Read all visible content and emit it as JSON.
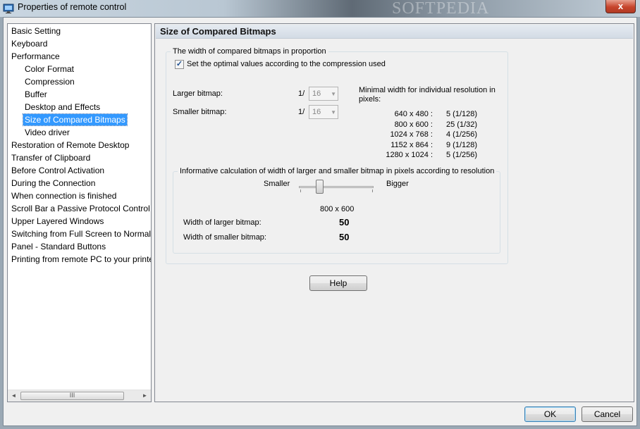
{
  "window": {
    "title": "Properties of remote control",
    "close_glyph": "x",
    "watermark": "SOFTPEDIA"
  },
  "tree": {
    "items": [
      {
        "label": "Basic Setting",
        "level": 0
      },
      {
        "label": "Keyboard",
        "level": 0
      },
      {
        "label": "Performance",
        "level": 0
      },
      {
        "label": "Color Format",
        "level": 1
      },
      {
        "label": "Compression",
        "level": 1
      },
      {
        "label": "Buffer",
        "level": 1
      },
      {
        "label": "Desktop and Effects",
        "level": 1
      },
      {
        "label": "Size of Compared Bitmaps",
        "level": 1,
        "selected": true
      },
      {
        "label": "Video driver",
        "level": 1
      },
      {
        "label": "Restoration of Remote Desktop",
        "level": 0
      },
      {
        "label": "Transfer of Clipboard",
        "level": 0
      },
      {
        "label": "Before Control Activation",
        "level": 0
      },
      {
        "label": "During the Connection",
        "level": 0
      },
      {
        "label": "When connection is finished",
        "level": 0
      },
      {
        "label": "Scroll Bar a Passive Protocol Control",
        "level": 0
      },
      {
        "label": "Upper Layered Windows",
        "level": 0
      },
      {
        "label": "Switching from Full Screen to Normal",
        "level": 0
      },
      {
        "label": "Panel - Standard Buttons",
        "level": 0
      },
      {
        "label": "Printing from remote PC to your printer",
        "level": 0
      }
    ],
    "scroll_left": "◄",
    "scroll_right": "►",
    "scroll_grip": "III"
  },
  "panel": {
    "title": "Size of Compared Bitmaps",
    "proportion_group": {
      "title": "The width of compared bitmaps in proportion",
      "optimal_checkbox_label": "Set the optimal values according to the compression used",
      "optimal_checked": true,
      "larger_label": "Larger bitmap:",
      "smaller_label": "Smaller bitmap:",
      "ratio_prefix": "1/",
      "larger_value": "16",
      "smaller_value": "16",
      "minimal_width_label": "Minimal width for individual resolution in pixels:",
      "resolutions": [
        "640 x 480 :",
        "800 x 600 :",
        "1024 x 768 :",
        "1152 x 864 :",
        "1280 x 1024 :"
      ],
      "resolution_values": [
        "5 (1/128)",
        "25 (1/32)",
        "4 (1/256)",
        "9 (1/128)",
        "5 (1/256)"
      ]
    },
    "informative_group": {
      "title": "Informative calculation of width of larger and smaller bitmap in pixels according to resolution",
      "smaller_label": "Smaller",
      "bigger_label": "Bigger",
      "slider_level": 0.25,
      "current_resolution": "800 x 600",
      "larger_width_label": "Width of larger bitmap:",
      "larger_width_value": "50",
      "smaller_width_label": "Width of smaller bitmap:",
      "smaller_width_value": "50"
    },
    "help_label": "Help"
  },
  "footer": {
    "ok_label": "OK",
    "cancel_label": "Cancel"
  }
}
